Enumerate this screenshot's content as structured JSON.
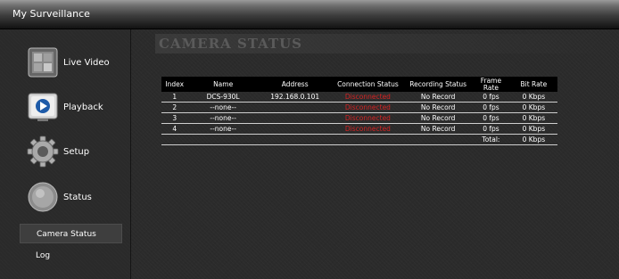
{
  "app": {
    "title": "My Surveillance"
  },
  "sidebar": {
    "nav": [
      {
        "label": "Live Video",
        "icon": "live-video-icon"
      },
      {
        "label": "Playback",
        "icon": "playback-icon"
      },
      {
        "label": "Setup",
        "icon": "setup-gear-icon"
      },
      {
        "label": "Status",
        "icon": "status-icon"
      }
    ],
    "sub": [
      {
        "label": "Camera Status",
        "active": true
      },
      {
        "label": "Log",
        "active": false
      }
    ]
  },
  "main": {
    "page_title": "CAMERA STATUS",
    "columns": [
      "Index",
      "Name",
      "Address",
      "Connection Status",
      "Recording Status",
      "Frame Rate",
      "Bit Rate"
    ],
    "rows": [
      {
        "index": "1",
        "name": "DCS-930L",
        "address": "192.168.0.101",
        "connection": "Disconnected",
        "recording": "No Record",
        "frame_rate": "0 fps",
        "bit_rate": "0 Kbps"
      },
      {
        "index": "2",
        "name": "--none--",
        "address": "",
        "connection": "Disconnected",
        "recording": "No Record",
        "frame_rate": "0 fps",
        "bit_rate": "0 Kbps"
      },
      {
        "index": "3",
        "name": "--none--",
        "address": "",
        "connection": "Disconnected",
        "recording": "No Record",
        "frame_rate": "0 fps",
        "bit_rate": "0 Kbps"
      },
      {
        "index": "4",
        "name": "--none--",
        "address": "",
        "connection": "Disconnected",
        "recording": "No Record",
        "frame_rate": "0 fps",
        "bit_rate": "0 Kbps"
      }
    ],
    "total": {
      "label": "Total:",
      "bit_rate": "0 Kbps"
    }
  },
  "colors": {
    "disconnected": "#d42222"
  }
}
